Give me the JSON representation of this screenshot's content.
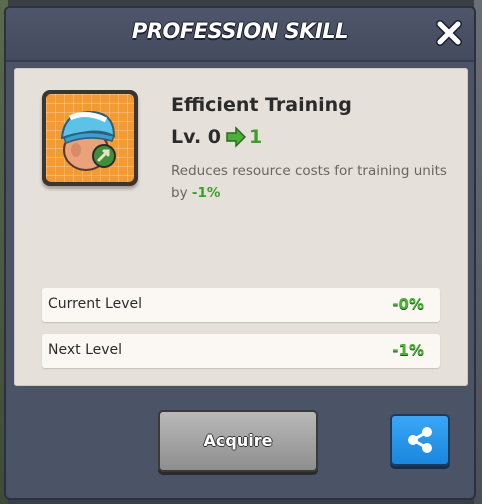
{
  "dialog": {
    "title": "PROFESSION SKILL"
  },
  "skill": {
    "name": "Efficient Training",
    "level_prefix": "Lv. 0",
    "next_level": "1",
    "description_text": "Reduces resource costs for training units by ",
    "description_value": "-1%",
    "icon": "helmet-head-icon"
  },
  "stats": [
    {
      "label": "Current Level",
      "value": "-0%"
    },
    {
      "label": "Next Level",
      "value": "-1%"
    }
  ],
  "actions": {
    "acquire_label": "Acquire",
    "share_icon": "share-icon",
    "close_icon": "close-icon"
  },
  "colors": {
    "positive": "#4caf3a",
    "header": "#4b5366",
    "share_button": "#2596ea",
    "icon_background": "#f39a32"
  }
}
